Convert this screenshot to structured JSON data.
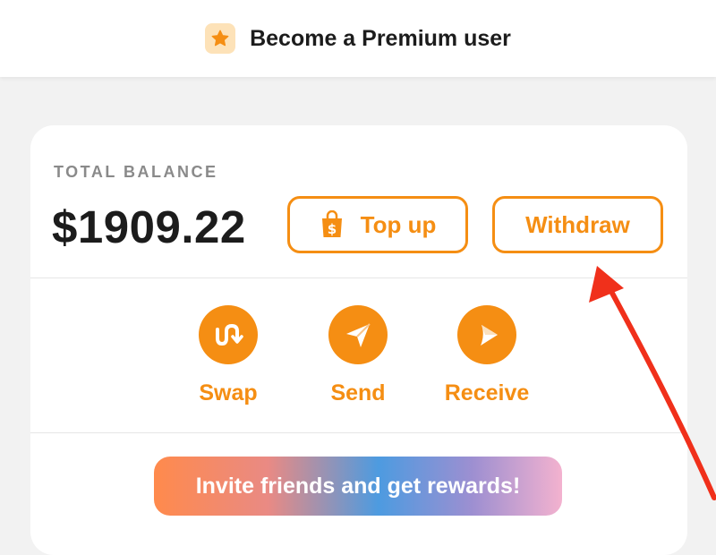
{
  "header": {
    "premium_label": "Become a Premium user",
    "premium_icon": "star-icon"
  },
  "balance": {
    "label": "TOTAL BALANCE",
    "amount": "$1909.22"
  },
  "buttons": {
    "topup_label": "Top up",
    "topup_icon": "shopping-bag-dollar-icon",
    "withdraw_label": "Withdraw"
  },
  "actions": [
    {
      "label": "Swap",
      "icon": "swap-icon"
    },
    {
      "label": "Send",
      "icon": "paper-plane-icon"
    },
    {
      "label": "Receive",
      "icon": "play-arrow-icon"
    }
  ],
  "invite": {
    "label": "Invite friends and get rewards!"
  },
  "colors": {
    "accent": "#f58e13",
    "badge_bg": "#fde2b8",
    "annotation_arrow": "#f0301b",
    "page_bg": "#f2f2f2"
  }
}
